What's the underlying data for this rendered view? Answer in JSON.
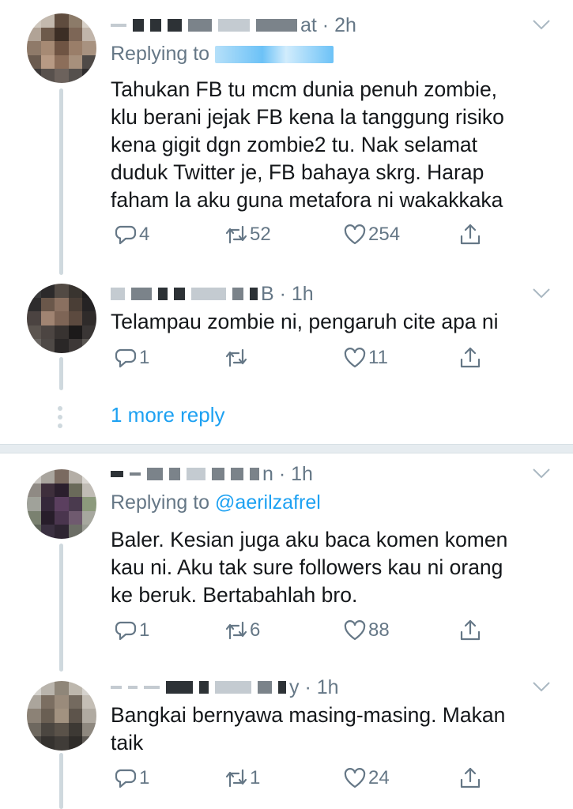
{
  "tweets": [
    {
      "meta": "at · 2h",
      "replying_label": "Replying to",
      "replying_handle": "",
      "text": "Tahukan FB tu mcm dunia penuh zombie,\nklu berani jejak FB kena la tanggung risiko\nkena gigit dgn zombie2 tu. Nak selamat\nduduk Twitter je, FB bahaya skrg. Harap\nfaham la aku guna metafora ni wakakkaka",
      "replies": "4",
      "retweets": "52",
      "likes": "254",
      "icons": [
        "reply-icon",
        "retweet-icon",
        "like-icon",
        "share-icon",
        "chevron-down-icon"
      ]
    },
    {
      "meta": "B · 1h",
      "text": "Telampau zombie ni, pengaruh cite apa ni",
      "replies": "1",
      "retweets": "",
      "likes": "11"
    },
    {
      "meta": "n · 1h",
      "replying_label": "Replying to",
      "replying_handle": "@aerilzafrel",
      "text": "Baler. Kesian juga aku baca komen komen\nkau ni. Aku tak sure followers kau ni orang\nke beruk. Bertabahlah bro.",
      "replies": "1",
      "retweets": "6",
      "likes": "88"
    },
    {
      "meta": "y · 1h",
      "text": "Bangkai bernyawa masing-masing. Makan\ntaik",
      "replies": "1",
      "retweets": "1",
      "likes": "24"
    }
  ],
  "more_reply": "1 more reply",
  "colors": {
    "accent": "#1da1f2",
    "muted": "#657786",
    "text": "#14171a",
    "thread_line": "#cfd9de",
    "separator": "#e6ecf0"
  }
}
